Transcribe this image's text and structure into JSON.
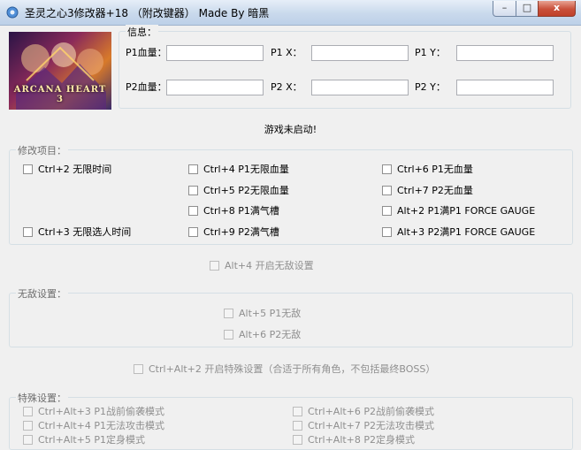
{
  "window": {
    "title": "圣灵之心3修改器+18 （附改键器） Made By 暗黑",
    "min_glyph": "–",
    "max_glyph": "□",
    "close_glyph": "x"
  },
  "logo": {
    "text": "ARCANA HEART 3"
  },
  "info": {
    "legend": "信息：",
    "p1_hp_label": "P1血量：",
    "p1_x_label": "P1 X：",
    "p1_y_label": "P1 Y：",
    "p2_hp_label": "P2血量：",
    "p2_x_label": "P2 X：",
    "p2_y_label": "P2 Y：",
    "p1_hp_value": "",
    "p1_x_value": "",
    "p1_y_value": "",
    "p2_hp_value": "",
    "p2_x_value": "",
    "p2_y_value": ""
  },
  "status_text": "游戏未启动!",
  "modify": {
    "legend": "修改项目：",
    "col1": [
      "Ctrl+2 无限时间",
      "Ctrl+3 无限选人时间"
    ],
    "col2": [
      "Ctrl+4 P1无限血量",
      "Ctrl+5 P2无限血量",
      "Ctrl+8 P1满气槽",
      "Ctrl+9 P2满气槽"
    ],
    "col3": [
      "Ctrl+6 P1无血量",
      "Ctrl+7 P2无血量",
      "Alt+2 P1满P1 FORCE GAUGE",
      "Alt+3 P2满P1 FORCE GAUGE"
    ]
  },
  "invincible_toggle": "Alt+4 开启无敌设置",
  "invincible": {
    "legend": "无敌设置：",
    "items": [
      "Alt+5 P1无敌",
      "Alt+6 P2无敌"
    ]
  },
  "special_toggle": "Ctrl+Alt+2 开启特殊设置（合适于所有角色，不包括最终BOSS）",
  "special": {
    "legend": "特殊设置：",
    "left": [
      "Ctrl+Alt+3 P1战前偷袭模式",
      "Ctrl+Alt+4 P1无法攻击模式",
      "Ctrl+Alt+5 P1定身模式"
    ],
    "right": [
      "Ctrl+Alt+6 P2战前偷袭模式",
      "Ctrl+Alt+7 P2无法攻击模式",
      "Ctrl+Alt+8 P2定身模式"
    ]
  }
}
